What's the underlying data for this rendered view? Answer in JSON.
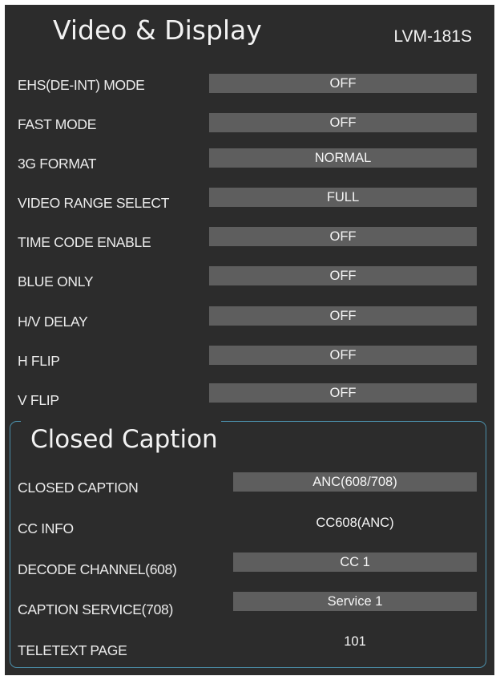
{
  "header": {
    "title": "Video & Display",
    "model": "LVM-181S"
  },
  "video": [
    {
      "label": "EHS(DE-INT) MODE",
      "value": "OFF"
    },
    {
      "label": "FAST MODE",
      "value": "OFF"
    },
    {
      "label": "3G FORMAT",
      "value": "NORMAL"
    },
    {
      "label": "VIDEO RANGE SELECT",
      "value": "FULL"
    },
    {
      "label": "TIME CODE ENABLE",
      "value": "OFF"
    },
    {
      "label": "BLUE ONLY",
      "value": "OFF"
    },
    {
      "label": "H/V DELAY",
      "value": "OFF"
    },
    {
      "label": "H FLIP",
      "value": "OFF"
    },
    {
      "label": "V FLIP",
      "value": "OFF"
    }
  ],
  "closed_caption": {
    "title": "Closed Caption",
    "items": [
      {
        "label": "CLOSED CAPTION",
        "value": "ANC(608/708)"
      },
      {
        "label": "CC INFO",
        "value": "CC608(ANC)"
      },
      {
        "label": "DECODE CHANNEL(608)",
        "value": "CC 1"
      },
      {
        "label": "CAPTION SERVICE(708)",
        "value": "Service 1"
      },
      {
        "label": "TELETEXT PAGE",
        "value": "101"
      }
    ]
  },
  "colors": {
    "background": "#2c2c2c",
    "value_bar": "#5e5e5e",
    "cc_border": "#4b8faa"
  }
}
